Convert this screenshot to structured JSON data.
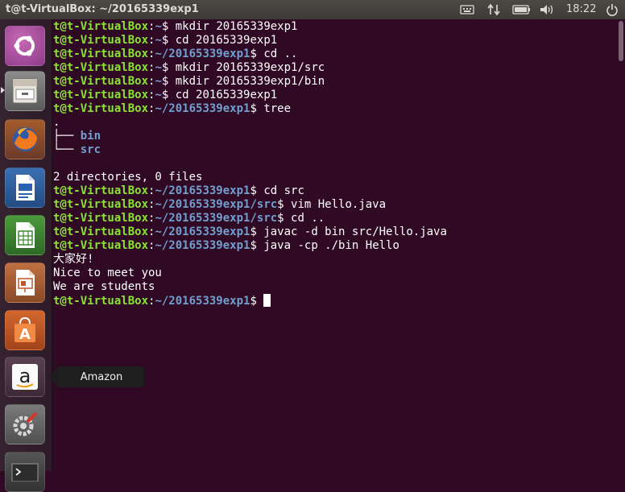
{
  "topbar": {
    "title": "t@t-VirtualBox: ~/20165339exp1",
    "clock": "18:22",
    "tray_icons": [
      "keyboard-icon",
      "network-icon",
      "battery-icon",
      "volume-icon",
      "power-icon"
    ]
  },
  "launcher": {
    "items": [
      {
        "name": "ubuntu-dash",
        "icon": "ubuntu-logo-icon"
      },
      {
        "name": "files",
        "icon": "file-cabinet-icon"
      },
      {
        "name": "firefox",
        "icon": "firefox-icon"
      },
      {
        "name": "libreoffice-writer",
        "icon": "writer-icon"
      },
      {
        "name": "libreoffice-calc",
        "icon": "calc-icon"
      },
      {
        "name": "libreoffice-impress",
        "icon": "impress-icon"
      },
      {
        "name": "ubuntu-software",
        "icon": "software-bag-icon"
      },
      {
        "name": "amazon",
        "icon": "amazon-icon"
      },
      {
        "name": "system-settings",
        "icon": "settings-icon"
      },
      {
        "name": "terminal",
        "icon": "terminal-icon"
      }
    ],
    "tooltip": "Amazon"
  },
  "terminal": {
    "user": "t@t-VirtualBox",
    "lines": [
      {
        "path": "~",
        "cmd": "mkdir 20165339exp1"
      },
      {
        "path": "~",
        "cmd": "cd 20165339exp1"
      },
      {
        "path": "~/20165339exp1",
        "cmd": "cd .."
      },
      {
        "path": "~",
        "cmd": "mkdir 20165339exp1/src"
      },
      {
        "path": "~",
        "cmd": "mkdir 20165339exp1/bin"
      },
      {
        "path": "~",
        "cmd": "cd 20165339exp1"
      },
      {
        "path": "~/20165339exp1",
        "cmd": "tree"
      },
      {
        "text": "."
      },
      {
        "tree": "├── ",
        "dir": "bin"
      },
      {
        "tree": "└── ",
        "dir": "src"
      },
      {
        "text": ""
      },
      {
        "text": "2 directories, 0 files"
      },
      {
        "path": "~/20165339exp1",
        "cmd": "cd src"
      },
      {
        "path": "~/20165339exp1/src",
        "cmd": "vim Hello.java"
      },
      {
        "path": "~/20165339exp1/src",
        "cmd": "cd .."
      },
      {
        "path": "~/20165339exp1",
        "cmd": "javac -d bin src/Hello.java"
      },
      {
        "path": "~/20165339exp1",
        "cmd": "java -cp ./bin Hello"
      },
      {
        "text": "大家好!"
      },
      {
        "text": "Nice to meet you"
      },
      {
        "text": "We are students"
      },
      {
        "path": "~/20165339exp1",
        "cmd": "",
        "cursor": true
      }
    ]
  },
  "colors": {
    "background": "#300a24",
    "user": "#8ae234",
    "path": "#729fcf"
  }
}
